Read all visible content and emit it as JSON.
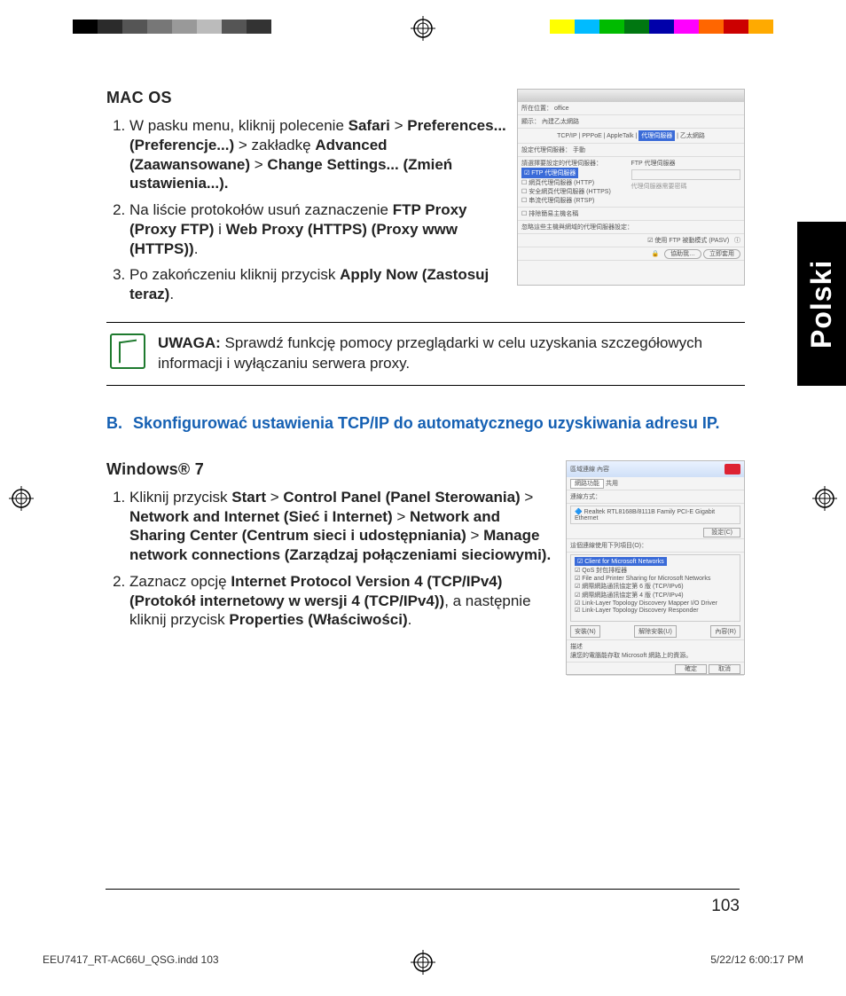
{
  "language_tab": "Polski",
  "page_number": "103",
  "footer_left": "EEU7417_RT-AC66U_QSG.indd   103",
  "footer_right": "5/22/12   6:00:17 PM",
  "macos": {
    "title": "MAC OS",
    "step1_a": "W pasku menu, kliknij polecenie ",
    "step1_b": "Safari",
    "step1_c": " > ",
    "step1_d": "Preferences... (Preferencje...)",
    "step1_e": " > zakładkę ",
    "step1_f": "Advanced (Zaawansowane)",
    "step1_g": " > ",
    "step1_h": "Change  Settings... (Zmień ustawienia...).",
    "step2_a": "Na liście protokołów usuń zaznaczenie ",
    "step2_b": "FTP Proxy (Proxy FTP)",
    "step2_c": " i ",
    "step2_d": "Web Proxy (HTTPS) (Proxy www (HTTPS))",
    "step2_e": ".",
    "step3_a": "Po zakończeniu kliknij przycisk  ",
    "step3_b": "Apply Now (Zastosuj teraz)",
    "step3_c": "."
  },
  "note": {
    "label": "UWAGA:",
    "text": "   Sprawdź funkcję pomocy przeglądarki w celu uzyskania szczegółowych informacji i wyłączaniu serwera proxy."
  },
  "section_b": {
    "prefix": "B.",
    "text": "Skonfigurować ustawienia TCP/IP do automatycznego uzyskiwania adresu IP."
  },
  "win7": {
    "title": "Windows® 7",
    "step1_a": "Kliknij przycisk ",
    "step1_b": "Start",
    "step1_c": " > ",
    "step1_d": "Control Panel (Panel Sterowania)",
    "step1_e": " > ",
    "step1_f": "Network and Internet (Sieć i Internet)",
    "step1_g": " > ",
    "step1_h": "Network and Sharing Center (Centrum sieci i udostępniania)",
    "step1_i": " > ",
    "step1_j": "Manage network connections (Zarządzaj połączeniami sieciowymi).",
    "step2_a": "Zaznacz opcję ",
    "step2_b": "Internet Protocol Version 4 (TCP/IPv4) (Protokół internetowy w wersji 4 (TCP/IPv4))",
    "step2_c": ", a następnie kliknij przycisk ",
    "step2_d": "Properties (Właściwości)",
    "step2_e": "."
  },
  "mac_window": {
    "tabs": [
      "TCP/IP",
      "PPPoE",
      "AppleTalk",
      "代理伺服器",
      "乙太網路"
    ],
    "location_label": "所在位置：",
    "location_value": "office",
    "show_label": "顯示：",
    "show_value": "內建乙太網路",
    "proxy_mode_label": "設定代理伺服器：",
    "proxy_mode_value": "手動",
    "left_list_title": "請選擇要設定的代理伺服器：",
    "right_title": "FTP 代理伺服器",
    "items": [
      "FTP 代理伺服器",
      "網頁代理伺服器 (HTTP)",
      "安全網頁代理伺服器 (HTTPS)",
      "串流代理伺服器 (RTSP)"
    ],
    "bypass1": "排除簡易主機名稱",
    "bypass2": "忽略這些主機與網域的代理伺服器設定：",
    "pasv": "使用 FTP 被動模式 (PASV)",
    "btn_assist": "協助我…",
    "btn_apply": "立即套用"
  },
  "win_window": {
    "title": "區域連線 內容",
    "tab1": "網路功能",
    "tab2": "共用",
    "connect_using": "連線方式：",
    "adapter": "Realtek RTL8168B/8111B Family PCI-E Gigabit Ethernet",
    "btn_configure": "設定(C)",
    "list_label": "這個連線使用下列項目(O)：",
    "items": [
      "Client for Microsoft Networks",
      "QoS 封包排程器",
      "File and Printer Sharing for Microsoft Networks",
      "網際網路通訊協定第 6 版 (TCP/IPv6)",
      "網際網路通訊協定第 4 版 (TCP/IPv4)",
      "Link-Layer Topology Discovery Mapper I/O Driver",
      "Link-Layer Topology Discovery Responder"
    ],
    "btn_install": "安裝(N)",
    "btn_uninstall": "解除安裝(U)",
    "btn_properties": "內容(R)",
    "desc_label": "描述",
    "desc_text": "讓您的電腦能存取 Microsoft 網路上的資源。",
    "btn_ok": "確定",
    "btn_cancel": "取消"
  }
}
